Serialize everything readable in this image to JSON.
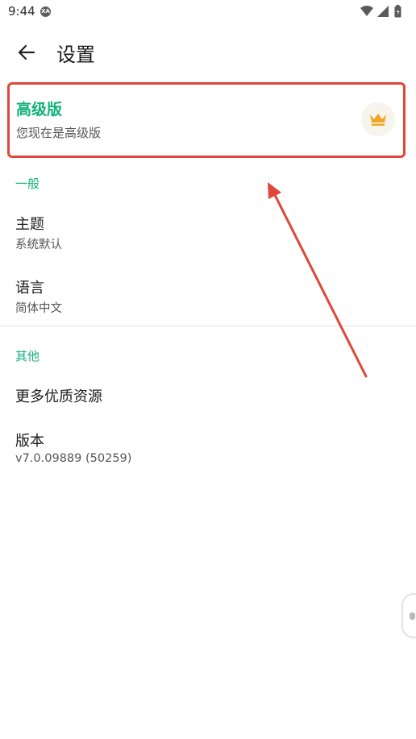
{
  "status_bar": {
    "time": "9:44",
    "a11y_badge": "XA",
    "icons": [
      "wifi-icon",
      "signal-icon",
      "battery-icon"
    ]
  },
  "app_bar": {
    "back_icon": "arrow-left-icon",
    "title": "设置"
  },
  "premium": {
    "title": "高级版",
    "subtitle": "您现在是高级版",
    "icon": "crown-icon"
  },
  "sections": {
    "general": {
      "header": "一般",
      "items": [
        {
          "title": "主题",
          "subtitle": "系统默认"
        },
        {
          "title": "语言",
          "subtitle": "简体中文"
        }
      ]
    },
    "other": {
      "header": "其他",
      "items": [
        {
          "title": "更多优质资源"
        },
        {
          "title": "版本",
          "subtitle": "v7.0.09889 (50259)"
        }
      ]
    }
  },
  "colors": {
    "accent": "#13b17a",
    "highlight": "#e0463a",
    "crown": "#f0a623"
  }
}
